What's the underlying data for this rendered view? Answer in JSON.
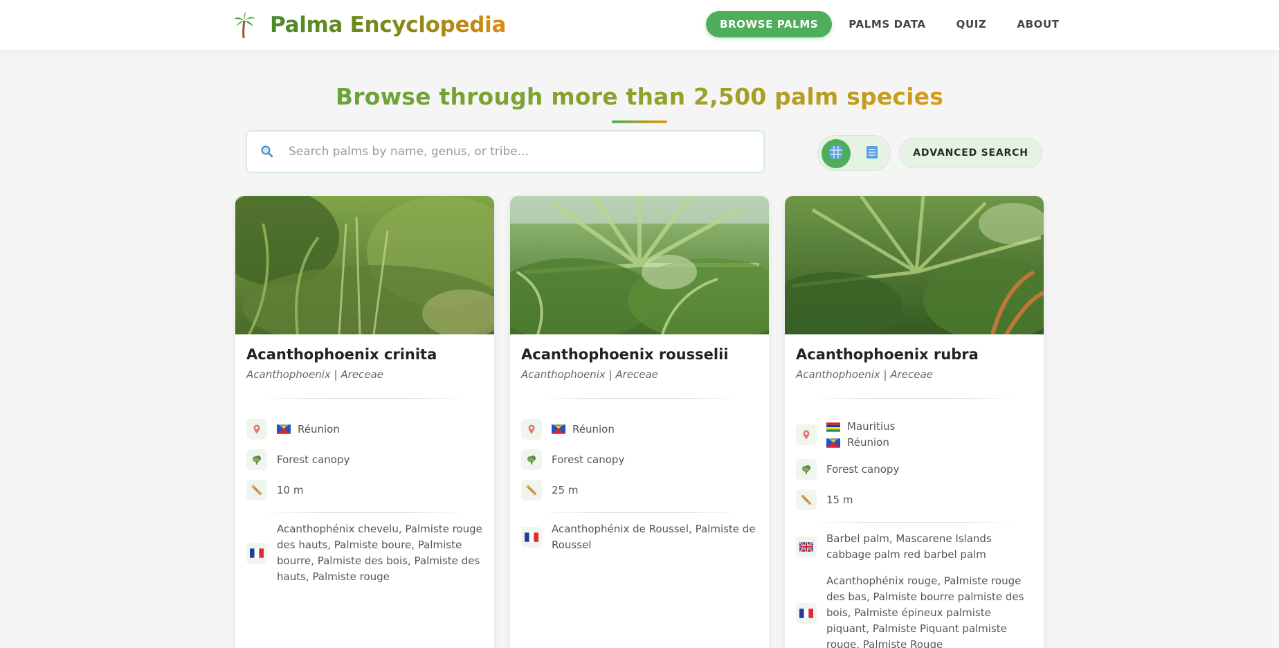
{
  "brand": {
    "title": "Palma Encyclopedia",
    "logo_icon": "palm-tree-icon"
  },
  "nav": {
    "items": [
      "BROWSE PALMS",
      "PALMS DATA",
      "QUIZ",
      "ABOUT"
    ],
    "active": "BROWSE PALMS"
  },
  "hero": {
    "title": "Browse through more than 2,500 palm species"
  },
  "search": {
    "placeholder": "Search palms by name, genus, or tribe...",
    "value": "",
    "icon": "search-icon"
  },
  "view_toggle": {
    "grid_icon": "grid-view-icon",
    "list_icon": "list-view-icon",
    "active": "grid"
  },
  "advanced_search": {
    "label": "ADVANCED SEARCH"
  },
  "colors": {
    "accent": "#4fae5c",
    "accent_light": "#e6f2e4",
    "brand_orange": "#e08a10"
  },
  "cards": [
    {
      "name": "Acanthophoenix crinita",
      "taxonomy": "Acanthophoenix | Areceae",
      "regions": [
        "Réunion"
      ],
      "habitat": "Forest canopy",
      "height": "10 m",
      "common_names": [
        {
          "flag": "france",
          "names": "Acanthophénix chevelu, Palmiste rouge des hauts, Palmiste boure, Palmiste bourre, Palmiste des bois, Palmiste des hauts, Palmiste rouge"
        }
      ]
    },
    {
      "name": "Acanthophoenix rousselii",
      "taxonomy": "Acanthophoenix | Areceae",
      "regions": [
        "Réunion"
      ],
      "habitat": "Forest canopy",
      "height": "25 m",
      "common_names": [
        {
          "flag": "france",
          "names": "Acanthophénix de Roussel, Palmiste de Roussel"
        }
      ]
    },
    {
      "name": "Acanthophoenix rubra",
      "taxonomy": "Acanthophoenix | Areceae",
      "regions": [
        "Mauritius",
        "Réunion"
      ],
      "habitat": "Forest canopy",
      "height": "15 m",
      "common_names": [
        {
          "flag": "uk",
          "names": "Barbel palm, Mascarene Islands cabbage palm red barbel palm"
        },
        {
          "flag": "france",
          "names": "Acanthophénix rouge, Palmiste rouge des bas, Palmiste bourre palmiste des bois, Palmiste épineux palmiste piquant, Palmiste Piquant palmiste rouge, Palmiste Rouge"
        }
      ]
    }
  ]
}
